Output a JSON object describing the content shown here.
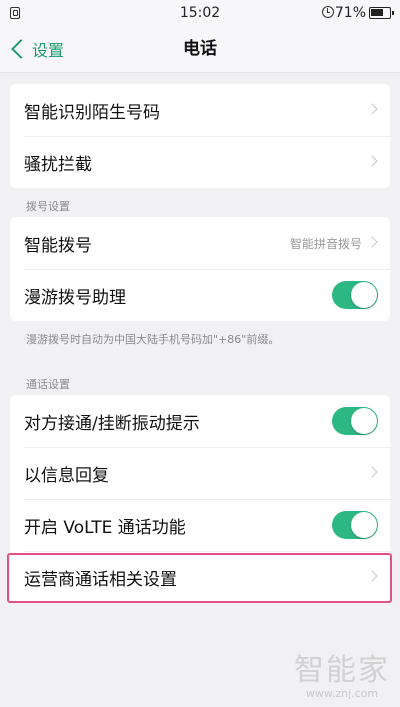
{
  "status_bar": {
    "time": "15:02",
    "battery_percent": "71%",
    "battery_level": 0.71
  },
  "nav": {
    "back_label": "设置",
    "title": "电话"
  },
  "group1": {
    "items": [
      {
        "label": "智能识别陌生号码"
      },
      {
        "label": "骚扰拦截"
      }
    ]
  },
  "dial_section": {
    "header": "拨号设置",
    "items": [
      {
        "label": "智能拨号",
        "value": "智能拼音拨号"
      },
      {
        "label": "漫游拨号助理",
        "toggle_on": true
      }
    ],
    "note": "漫游拨号时自动为中国大陆手机号码加\"+86\"前缀。"
  },
  "call_section": {
    "header": "通话设置",
    "items": [
      {
        "label": "对方接通/挂断振动提示",
        "toggle_on": true
      },
      {
        "label": "以信息回复"
      },
      {
        "label": "开启 VoLTE 通话功能",
        "toggle_on": true
      },
      {
        "label": "运营商通话相关设置"
      }
    ]
  },
  "watermark": {
    "title": "智能家",
    "url": "www.znj.com"
  },
  "colors": {
    "accent": "#1f9b6b",
    "toggle_on": "#2db783",
    "highlight": "#e04f86"
  },
  "icons": [
    "lock-icon",
    "alarm-icon",
    "battery-icon",
    "back-chevron-icon",
    "chevron-right-icon"
  ]
}
